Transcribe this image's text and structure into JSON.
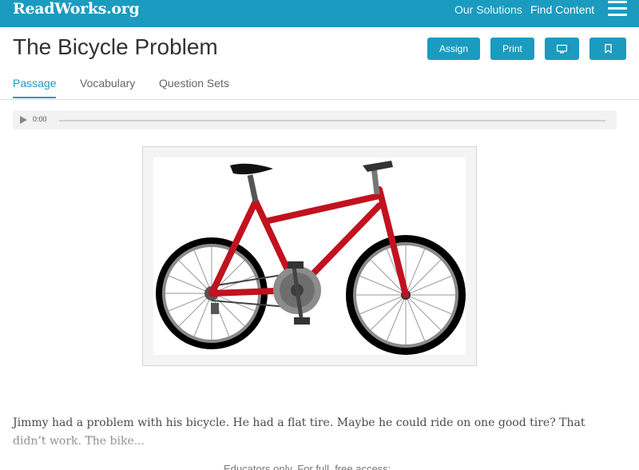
{
  "header": {
    "logo": "ReadWorks.org",
    "nav": [
      "Our Solutions",
      "Find Content"
    ],
    "menu_icon": "hamburger-menu-icon"
  },
  "title": "The Bicycle Problem",
  "actions": {
    "assign": "Assign",
    "print": "Print",
    "present_icon": "monitor-icon",
    "bookmark_icon": "bookmark-icon"
  },
  "tabs": [
    "Passage",
    "Vocabulary",
    "Question Sets"
  ],
  "active_tab": "Passage",
  "audio": {
    "time": "0:00",
    "play_icon": "play-icon",
    "progress": 0
  },
  "image": {
    "subject": "red bicycle illustration"
  },
  "passage": {
    "text": "Jimmy had a problem with his bicycle. He had a flat tire. Maybe he could ride on one good tire? That didn’t work. The bike..."
  },
  "footer_note": "Educators only. For full, free access:",
  "colors": {
    "brand": "#1a9bbf",
    "bike_frame": "#c1121f"
  }
}
